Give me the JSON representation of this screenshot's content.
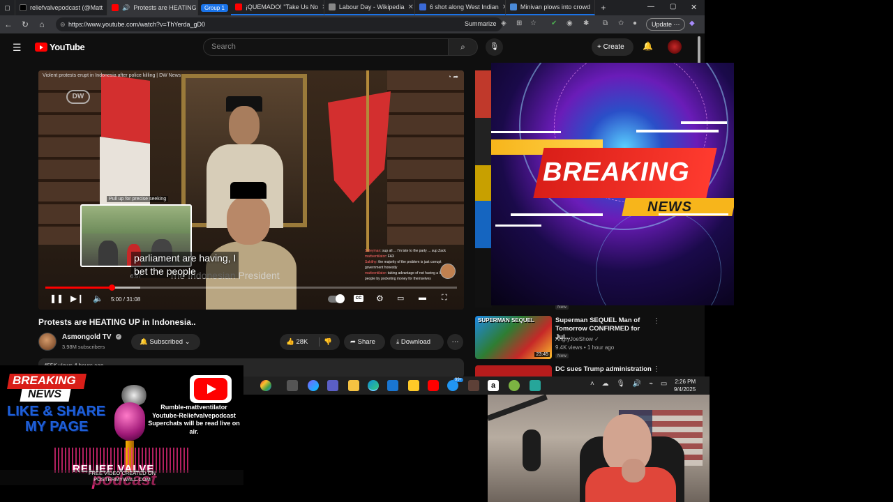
{
  "browser": {
    "tabs": [
      {
        "label": "reliefvalvepodcast (@Matt",
        "color": "#000000",
        "active": false
      },
      {
        "label": "Protests are HEATING",
        "color": "#ff0000",
        "active": true
      },
      {
        "label": "¡QUEMADO! \"Take Us No",
        "color": "#ff0000",
        "active": false
      },
      {
        "label": "Labour Day - Wikipedia",
        "color": "#888888",
        "active": false
      },
      {
        "label": "6 shot along West Indian",
        "color": "#3a6ad8",
        "active": false
      },
      {
        "label": "Minivan plows into crowd",
        "color": "#4a8ad8",
        "active": false
      }
    ],
    "group_label": "Group 1",
    "url": "https://www.youtube.com/watch?v=ThYerda_gD0",
    "summarize_label": "Summarize",
    "update_label": "Update"
  },
  "youtube": {
    "logo_text": "YouTube",
    "search_placeholder": "Search",
    "create_label": "Create"
  },
  "player": {
    "top_line": "Violent protests erupt in Indonesia after police killing | DW News",
    "dw_logo": "DW",
    "seek_hint": "Pull up for precise seeking",
    "subtitle_line1": "parliament are having, I",
    "subtitle_line2": "bet the people",
    "lower_third": "Indonesian President",
    "thumb_time": "6:57",
    "time_label": "5:00 / 31:08",
    "progress_fraction": 0.161,
    "buffer_fraction": 0.23,
    "cc_label": "CC",
    "chat": [
      {
        "name": "Soleyman",
        "text": "sup all ... I'm late to the party ... sup Zack"
      },
      {
        "name": "mattventilator",
        "text": "FAX"
      },
      {
        "name": "Sakithy",
        "text": "the majority of the problem is just corrupt government honestly"
      },
      {
        "name": "mattventilator",
        "text": "taking advantage of not having a lot of poor people by pocketing money for themselves"
      }
    ]
  },
  "video": {
    "title": "Protests are HEATING UP in Indonesia..",
    "channel": "Asmongold TV",
    "subscribers": "3.98M subscribers",
    "subscribed_label": "Subscribed",
    "likes": "28K",
    "share_label": "Share",
    "download_label": "Download",
    "desc_preview": "455K views 4 hours ago"
  },
  "sidebar": {
    "items": [
      {
        "badge_top": "New",
        "title": "Superman SEQUEL Man of Tomorrow CONFIRMED for Jul...",
        "thumb_text": "SUPERMAN SEQUEL",
        "duration": "23:45",
        "channel": "AngryJoeShow",
        "meta": "9.4K views • 1 hour ago",
        "badge": "New"
      },
      {
        "title": "DC sues Trump administration"
      }
    ]
  },
  "overlay": {
    "breaking": "BREAKING",
    "news": "NEWS"
  },
  "taskbar": {
    "time": "2:26 PM",
    "date": "9/4/2025",
    "badge": "99+"
  },
  "promo": {
    "breaking": "BREAKING",
    "news": "NEWS",
    "like_share": "LIKE & SHARE",
    "my_page": "MY PAGE",
    "info": "Rumble-mattventilator Youtube-Reliefvalvepodcast Superchats will be read live on air.",
    "relief": "RELIEF VALVE",
    "podcast": "podcast",
    "credit_line1": "FREE VIDEO CREATED ON",
    "credit_line2": "POSTERMYWALL.COM"
  }
}
